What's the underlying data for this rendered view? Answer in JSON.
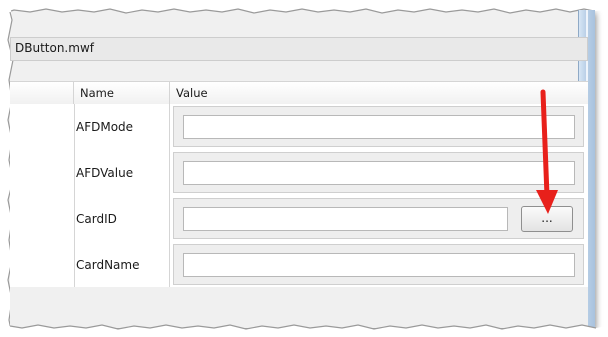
{
  "file": {
    "name": "DButton.mwf"
  },
  "grid": {
    "headers": {
      "name": "Name",
      "value": "Value"
    },
    "rows": [
      {
        "name": "AFDMode",
        "value": ""
      },
      {
        "name": "AFDValue",
        "value": ""
      },
      {
        "name": "CardID",
        "value": "",
        "button_label": "..."
      },
      {
        "name": "CardName",
        "value": ""
      }
    ]
  },
  "colors": {
    "arrow": "#e8201b",
    "scrollbar": "#b9cfe6"
  },
  "icons": {
    "arrow": "red-annotation-arrow"
  }
}
